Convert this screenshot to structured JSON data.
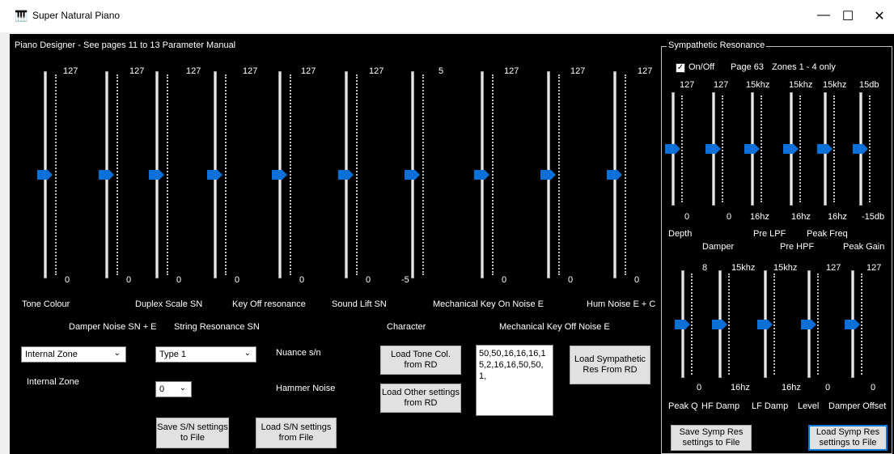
{
  "window": {
    "title": "Super Natural Piano",
    "minimize_glyph": "—",
    "maximize_glyph": "☐",
    "close_glyph": "✕"
  },
  "designer": {
    "header": "Piano Designer - See pages 11 to 13 Parameter Manual",
    "sliders": [
      {
        "max": "127",
        "min": "0",
        "level": 0.5
      },
      {
        "max": "127",
        "min": "0",
        "level": 0.5
      },
      {
        "max": "127",
        "min": "0",
        "level": 0.5
      },
      {
        "max": "127",
        "min": "0",
        "level": 0.5
      },
      {
        "max": "127",
        "min": "0",
        "level": 0.5
      },
      {
        "max": "127",
        "min": "0",
        "level": 0.5
      },
      {
        "max": "5",
        "min": "-5",
        "level": 0.5
      },
      {
        "max": "127",
        "min": "0",
        "level": 0.5
      },
      {
        "max": "127",
        "min": "0",
        "level": 0.5
      },
      {
        "max": "127",
        "min": "0",
        "level": 0.5
      }
    ],
    "labels": {
      "tone_colour": "Tone Colour",
      "duplex_scale": "Duplex Scale SN",
      "key_off_resonance": "Key Off resonance",
      "sound_lift": "Sound Lift SN",
      "mech_key_on": "Mechanical Key On Noise E",
      "hum_noise": "Hum Noise E + C",
      "damper_noise": "Damper Noise SN + E",
      "string_resonance": "String Resonance SN",
      "character": "Character",
      "mech_key_off": "Mechanical Key Off Noise E",
      "nuance": "Nuance s/n",
      "internal_zone": "Internal Zone",
      "hammer_noise": "Hammer Noise"
    },
    "zone_select": "Internal Zone",
    "type_select": "Type 1",
    "hammer_select": "0",
    "buttons": {
      "load_tone_col": "Load Tone Col. from RD",
      "load_other": "Load Other settings from RD",
      "load_sympathetic": "Load Sympathetic Res From RD",
      "save_sn": "Save S/N settings to File",
      "load_sn": "Load S/N settings from File"
    },
    "data_text": "50,50,16,16,16,15,2,16,16,50,50,1,"
  },
  "sympathetic": {
    "title": "Sympathetic Resonance",
    "onoff_label": "On/Off",
    "onoff_checked": true,
    "page_note": "Page 63",
    "zones_note": "Zones 1 - 4 only",
    "top_sliders": [
      {
        "max": "127",
        "min": "0",
        "level": 0.5
      },
      {
        "max": "127",
        "min": "0",
        "level": 0.5
      },
      {
        "max": "15khz",
        "min": "16hz",
        "level": 0.5
      },
      {
        "max": "15khz",
        "min": "16hz",
        "level": 0.5
      },
      {
        "max": "15khz",
        "min": "16hz",
        "level": 0.5
      },
      {
        "max": "15db",
        "min": "-15db",
        "level": 0.5
      }
    ],
    "top_labels": {
      "depth": "Depth",
      "damper": "Damper",
      "pre_lpf": "Pre LPF",
      "pre_hpf": "Pre HPF",
      "peak_freq": "Peak Freq",
      "peak_gain": "Peak Gain"
    },
    "bottom_sliders": [
      {
        "max": "8",
        "min": "0",
        "level": 0.5
      },
      {
        "max": "15khz",
        "min": "16hz",
        "level": 0.5
      },
      {
        "max": "15khz",
        "min": "16hz",
        "level": 0.5
      },
      {
        "max": "127",
        "min": "0",
        "level": 0.5
      },
      {
        "max": "127",
        "min": "0",
        "level": 0.5
      }
    ],
    "bottom_labels": {
      "peak_q": "Peak Q",
      "hf_damp": "HF Damp",
      "lf_damp": "LF Damp",
      "level": "Level",
      "damper_offset": "Damper Offset"
    },
    "buttons": {
      "save": "Save Symp Res settings to File",
      "load": "Load Symp Res settings to File"
    }
  },
  "colors": {
    "thumb": "#0a6fd6",
    "background": "#000000",
    "accent_focus": "#0078d7"
  },
  "icons": {
    "app": "piano-icon",
    "checkbox": "checkmark-icon",
    "dropdown": "chevron-down-icon"
  }
}
